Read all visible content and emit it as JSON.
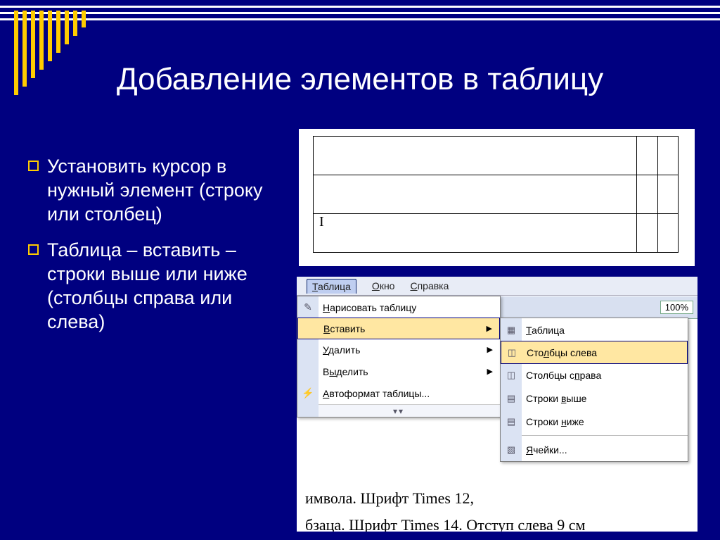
{
  "slide": {
    "title": "Добавление элементов в таблицу",
    "bullets": [
      "Установить курсор в нужный элемент (строку или столбец)",
      "Таблица – вставить – строки выше или ниже (столбцы справа или слева)"
    ]
  },
  "sample_table": {
    "rows": 3,
    "cols": 3,
    "cursor_cell_text": "I"
  },
  "word_ui": {
    "menubar": {
      "items": [
        {
          "label": "Таблица",
          "underline": "Т",
          "active": true
        },
        {
          "label": "Окно",
          "underline": "О",
          "active": false
        },
        {
          "label": "Справка",
          "underline": "С",
          "active": false
        }
      ]
    },
    "toolbar": {
      "zoom": "100%"
    },
    "menu_table": {
      "items": [
        {
          "label": "Нарисовать таблицу",
          "underline": "Н",
          "icon": "pencil",
          "submenu": false,
          "hover": false
        },
        {
          "label": "Вставить",
          "underline": "В",
          "icon": "",
          "submenu": true,
          "hover": true
        },
        {
          "label": "Удалить",
          "underline": "У",
          "icon": "",
          "submenu": true,
          "hover": false
        },
        {
          "label": "Выделить",
          "underline": "ы",
          "icon": "",
          "submenu": true,
          "hover": false
        },
        {
          "label": "Автоформат таблицы...",
          "underline": "А",
          "icon": "autofmt",
          "submenu": false,
          "hover": false
        }
      ],
      "expand_glyph": "▾▾"
    },
    "menu_insert": {
      "items": [
        {
          "label": "Таблица",
          "underline": "Т",
          "icon": "table",
          "hover": false
        },
        {
          "label": "Столбцы слева",
          "underline": "л",
          "icon": "col-left",
          "hover": true
        },
        {
          "label": "Столбцы справа",
          "underline": "п",
          "icon": "col-right",
          "hover": false
        },
        {
          "label": "Строки выше",
          "underline": "в",
          "icon": "row-above",
          "hover": false
        },
        {
          "label": "Строки ниже",
          "underline": "н",
          "icon": "row-below",
          "hover": false
        },
        {
          "sep": true
        },
        {
          "label": "Ячейки...",
          "underline": "Я",
          "icon": "cells",
          "hover": false
        }
      ]
    },
    "doc_fragments": [
      "имвола. Шрифт Times 12,",
      "бзаца. Шрифт Times 14. Отступ слева 9 см"
    ]
  },
  "decor": {
    "vbar_heights": [
      120,
      108,
      96,
      84,
      72,
      60,
      48,
      36,
      24
    ]
  }
}
